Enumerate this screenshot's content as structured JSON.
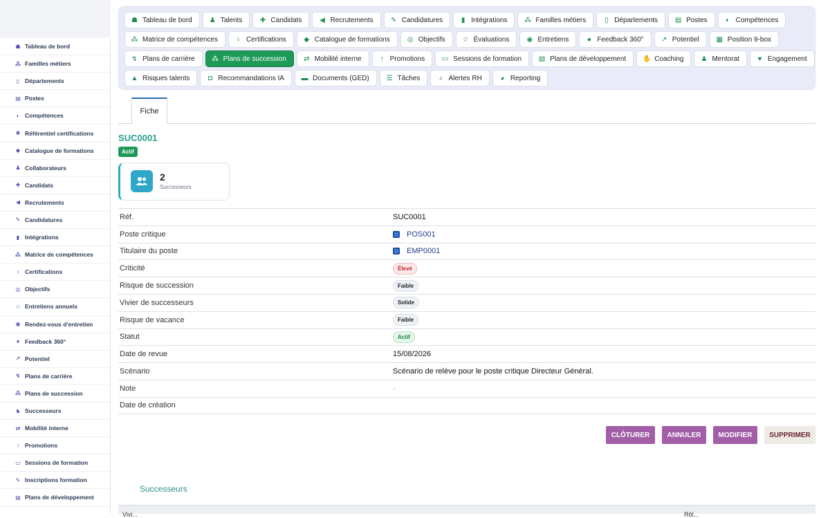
{
  "top_nav": {
    "rows": [
      [
        {
          "label": "Tableau de bord",
          "icon": "dashboard-icon",
          "glyph": "☗"
        },
        {
          "label": "Talents",
          "icon": "person-icon",
          "glyph": "♟"
        },
        {
          "label": "Candidats",
          "icon": "person-plus-icon",
          "glyph": "✚"
        },
        {
          "label": "Recrutements",
          "icon": "megaphone-icon",
          "glyph": "◀"
        },
        {
          "label": "Candidatures",
          "icon": "file-edit-icon",
          "glyph": "✎"
        },
        {
          "label": "Intégrations",
          "icon": "building-icon",
          "glyph": "▮"
        },
        {
          "label": "Familles métiers",
          "icon": "sitemap-icon",
          "glyph": "⁂"
        },
        {
          "label": "Départements",
          "icon": "office-icon",
          "glyph": "▯"
        },
        {
          "label": "Postes",
          "icon": "id-badge-icon",
          "glyph": "▤"
        },
        {
          "label": "Compétences",
          "icon": "brain-icon",
          "glyph": "◐"
        }
      ],
      [
        {
          "label": "Matrice de compétences",
          "icon": "sitemap-icon",
          "glyph": "⁂"
        },
        {
          "label": "Certifications",
          "icon": "ribbon-icon",
          "glyph": "♀"
        },
        {
          "label": "Catalogue de formations",
          "icon": "graduation-cap-icon",
          "glyph": "◆"
        },
        {
          "label": "Objectifs",
          "icon": "target-icon",
          "glyph": "◎"
        },
        {
          "label": "Évaluations",
          "icon": "star-icon",
          "glyph": "☆"
        },
        {
          "label": "Entretiens",
          "icon": "chat-icon",
          "glyph": "◉"
        },
        {
          "label": "Feedback 360°",
          "icon": "comment-icon",
          "glyph": "●"
        },
        {
          "label": "Potentiel",
          "icon": "chart-line-icon",
          "glyph": "↗"
        },
        {
          "label": "Position 9-box",
          "icon": "grid-icon",
          "glyph": "▦"
        }
      ],
      [
        {
          "label": "Plans de carrière",
          "icon": "route-icon",
          "glyph": "↯"
        },
        {
          "label": "Plans de succession",
          "icon": "sitemap-icon",
          "glyph": "⁂",
          "active": true
        },
        {
          "label": "Mobilité interne",
          "icon": "exchange-icon",
          "glyph": "⇄"
        },
        {
          "label": "Promotions",
          "icon": "arrow-up-icon",
          "glyph": "↑"
        },
        {
          "label": "Sessions de formation",
          "icon": "presentation-icon",
          "glyph": "▭"
        },
        {
          "label": "Plans de développement",
          "icon": "clipboard-icon",
          "glyph": "▤"
        },
        {
          "label": "Coaching",
          "icon": "handshake-icon",
          "glyph": "✋"
        },
        {
          "label": "Mentorat",
          "icon": "mentor-icon",
          "glyph": "♟"
        },
        {
          "label": "Engagement",
          "icon": "heart-icon",
          "glyph": "♥"
        }
      ],
      [
        {
          "label": "Risques talents",
          "icon": "warning-icon",
          "glyph": "▲"
        },
        {
          "label": "Recommandations IA",
          "icon": "robot-icon",
          "glyph": "◘"
        },
        {
          "label": "Documents (GED)",
          "icon": "folder-icon",
          "glyph": "▬"
        },
        {
          "label": "Tâches",
          "icon": "tasks-icon",
          "glyph": "☰"
        },
        {
          "label": "Alertes RH",
          "icon": "bell-icon",
          "glyph": "♪"
        },
        {
          "label": "Reporting",
          "icon": "pie-chart-icon",
          "glyph": "◕"
        }
      ]
    ]
  },
  "sidebar": {
    "items": [
      {
        "label": "Tableau de bord",
        "icon": "dashboard-icon",
        "glyph": "☗"
      },
      {
        "label": "Familles métiers",
        "icon": "sitemap-icon",
        "glyph": "⁂"
      },
      {
        "label": "Départements",
        "icon": "office-icon",
        "glyph": "▯"
      },
      {
        "label": "Postes",
        "icon": "id-badge-icon",
        "glyph": "▤"
      },
      {
        "label": "Compétences",
        "icon": "brain-icon",
        "glyph": "◐"
      },
      {
        "label": "Référentiel certifications",
        "icon": "certificate-icon",
        "glyph": "✺"
      },
      {
        "label": "Catalogue de formations",
        "icon": "graduation-cap-icon",
        "glyph": "◆"
      },
      {
        "label": "Collaborateurs",
        "icon": "person-icon",
        "glyph": "♟"
      },
      {
        "label": "Candidats",
        "icon": "person-plus-icon",
        "glyph": "✚"
      },
      {
        "label": "Recrutements",
        "icon": "megaphone-icon",
        "glyph": "◀"
      },
      {
        "label": "Candidatures",
        "icon": "file-edit-icon",
        "glyph": "✎"
      },
      {
        "label": "Intégrations",
        "icon": "building-icon",
        "glyph": "▮"
      },
      {
        "label": "Matrice de compétences",
        "icon": "sitemap-icon",
        "glyph": "⁂"
      },
      {
        "label": "Certifications",
        "icon": "ribbon-icon",
        "glyph": "♀"
      },
      {
        "label": "Objectifs",
        "icon": "target-icon",
        "glyph": "◎"
      },
      {
        "label": "Entretiens annuels",
        "icon": "star-icon",
        "glyph": "☆"
      },
      {
        "label": "Rendez-vous d'entretien",
        "icon": "chat-icon",
        "glyph": "◉"
      },
      {
        "label": "Feedback 360°",
        "icon": "comment-icon",
        "glyph": "●"
      },
      {
        "label": "Potentiel",
        "icon": "chart-line-icon",
        "glyph": "↗"
      },
      {
        "label": "Plans de carrière",
        "icon": "route-icon",
        "glyph": "↯"
      },
      {
        "label": "Plans de succession",
        "icon": "sitemap-icon",
        "glyph": "⁂"
      },
      {
        "label": "Successeurs",
        "icon": "users-icon",
        "glyph": "♞"
      },
      {
        "label": "Mobilité interne",
        "icon": "exchange-icon",
        "glyph": "⇄"
      },
      {
        "label": "Promotions",
        "icon": "arrow-up-icon",
        "glyph": "↑"
      },
      {
        "label": "Sessions de formation",
        "icon": "presentation-icon",
        "glyph": "▭"
      },
      {
        "label": "Inscriptions formation",
        "icon": "user-edit-icon",
        "glyph": "✎"
      },
      {
        "label": "Plans de développement",
        "icon": "clipboard-icon",
        "glyph": "▤"
      }
    ]
  },
  "tabs": {
    "fiche": "Fiche"
  },
  "record": {
    "ref_title": "SUC0001",
    "status_badge": "Actif",
    "stat": {
      "value": "2",
      "label": "Successeurs"
    }
  },
  "details": [
    {
      "label": "Réf.",
      "type": "text",
      "value": "SUC0001"
    },
    {
      "label": "Poste critique",
      "type": "link",
      "value": "POS001"
    },
    {
      "label": "Titulaire du poste",
      "type": "link",
      "value": "EMP0001"
    },
    {
      "label": "Criticité",
      "type": "pill-red",
      "value": "Élevé"
    },
    {
      "label": "Risque de succession",
      "type": "pill-gray",
      "value": "Faible"
    },
    {
      "label": "Vivier de successeurs",
      "type": "pill-gray",
      "value": "Solide"
    },
    {
      "label": "Risque de vacance",
      "type": "pill-gray",
      "value": "Faible"
    },
    {
      "label": "Statut",
      "type": "pill-green",
      "value": "Actif"
    },
    {
      "label": "Date de revue",
      "type": "text",
      "value": "15/08/2026"
    },
    {
      "label": "Scénario",
      "type": "text",
      "value": "Scénario de relève pour le poste critique Directeur Général."
    },
    {
      "label": "Note",
      "type": "dash",
      "value": "-"
    },
    {
      "label": "Date de création",
      "type": "text",
      "value": ""
    }
  ],
  "actions": {
    "cloturer": "CLÔTURER",
    "annuler": "ANNULER",
    "modifier": "MODIFIER",
    "supprimer": "SUPPRIMER"
  },
  "successeurs": {
    "title": "Successeurs",
    "header_left": "Vivi...",
    "header_right": "Rôl..."
  },
  "colors": {
    "accent_green": "#1e9a57",
    "teal": "#2a9d8f",
    "action_purple": "#a25fa8",
    "stat_blue": "#2ea7c9"
  }
}
